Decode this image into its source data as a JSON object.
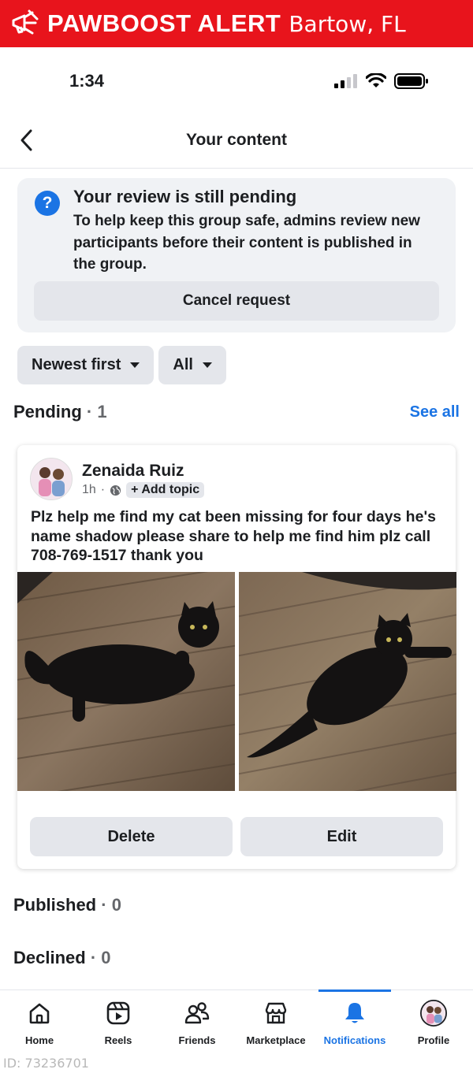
{
  "alert": {
    "brand": "PAWBOOST ALERT",
    "location": "Bartow, FL"
  },
  "status_bar": {
    "time": "1:34"
  },
  "nav": {
    "title": "Your content"
  },
  "review": {
    "title": "Your review is still pending",
    "body": "To help keep this group safe, admins review new participants before their content is published in the group.",
    "cancel_label": "Cancel request"
  },
  "filters": {
    "sort_label": "Newest first",
    "type_label": "All"
  },
  "pending": {
    "label": "Pending",
    "count": "· 1",
    "see_all": "See all"
  },
  "post": {
    "author": "Zenaida Ruiz",
    "time": "1h",
    "separator": "·",
    "topic_label": "+ Add topic",
    "text": "Plz help me find my cat been missing for four days he's name shadow please share to help me find him plz call 708-769-1517 thank you",
    "delete_label": "Delete",
    "edit_label": "Edit"
  },
  "published": {
    "label": "Published",
    "count": "· 0"
  },
  "declined": {
    "label": "Declined",
    "count": "· 0"
  },
  "tabbar": {
    "items": [
      {
        "label": "Home",
        "icon": "home-icon"
      },
      {
        "label": "Reels",
        "icon": "reels-icon"
      },
      {
        "label": "Friends",
        "icon": "friends-icon"
      },
      {
        "label": "Marketplace",
        "icon": "marketplace-icon"
      },
      {
        "label": "Notifications",
        "icon": "bell-icon",
        "active": true
      },
      {
        "label": "Profile",
        "icon": "profile-avatar"
      }
    ]
  },
  "footer_id": "ID: 73236701",
  "colors": {
    "alert_red": "#e8141c",
    "accent_blue": "#1b74e4",
    "muted_gray": "#65676b",
    "button_gray": "#e4e6eb",
    "card_gray": "#f0f2f5"
  }
}
